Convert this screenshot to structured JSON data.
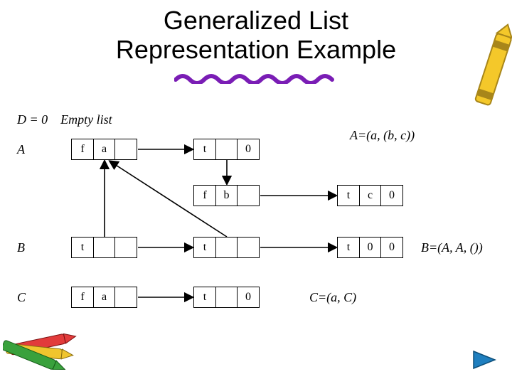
{
  "title_line1": "Generalized List",
  "title_line2": "Representation Example",
  "rows": {
    "D": {
      "label": "D = 0",
      "note": "Empty  list"
    },
    "A": {
      "label": "A",
      "annot": "A=(a, (b, c))"
    },
    "B": {
      "label": "B",
      "annot": "B=(A, A, ())"
    },
    "C": {
      "label": "C",
      "annot": "C=(a, C)"
    }
  },
  "nodes": {
    "A1": [
      "f",
      "a",
      ""
    ],
    "A2": [
      "t",
      "",
      "0"
    ],
    "A3": [
      "f",
      "b",
      ""
    ],
    "A4": [
      "t",
      "c",
      "0"
    ],
    "B1": [
      "t",
      "",
      ""
    ],
    "B2": [
      "t",
      "",
      ""
    ],
    "B3": [
      "t",
      "0",
      "0"
    ],
    "C1": [
      "f",
      "a",
      ""
    ],
    "C2": [
      "t",
      "",
      "0"
    ]
  },
  "colors": {
    "squiggle": "#7a1db5",
    "play": "#1f7fbf"
  }
}
